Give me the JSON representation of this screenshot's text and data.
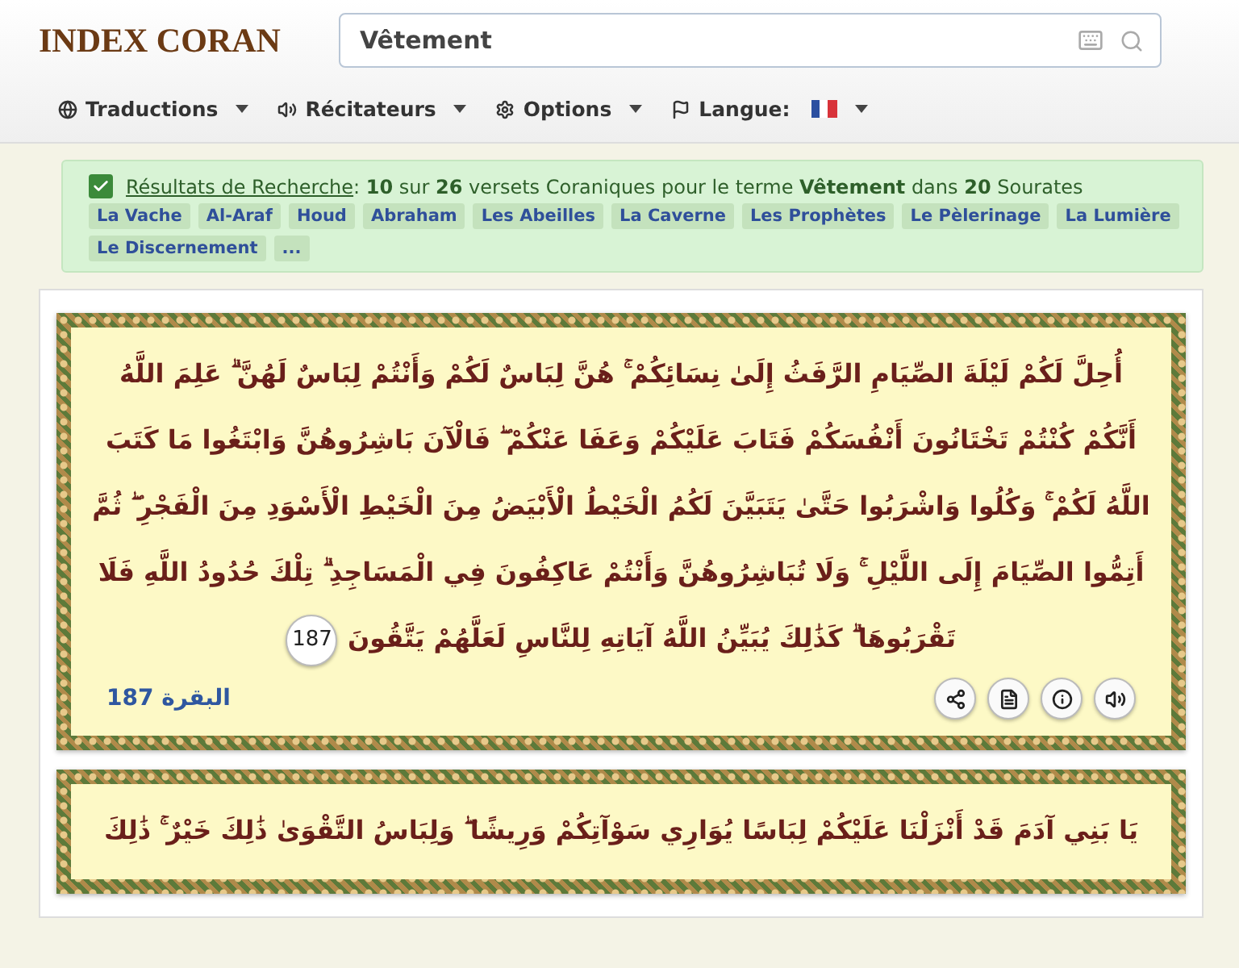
{
  "logo": {
    "text": "INDEX CORAN"
  },
  "search": {
    "value": "Vêtement"
  },
  "nav": [
    {
      "label": "Traductions",
      "kind": "menu"
    },
    {
      "label": "Récitateurs",
      "kind": "menu"
    },
    {
      "label": "Options",
      "kind": "menu"
    },
    {
      "label": "Langue:",
      "kind": "language"
    }
  ],
  "results": {
    "checked": true,
    "link": "Résultats de Recherche",
    "summary": ": **10** sur **26** versets Coraniques pour le terme **Vêtement** dans **20** Sourates",
    "tags": [
      "La Vache",
      "Al-Araf",
      "Houd",
      "Abraham",
      "Les Abeilles",
      "La Caverne",
      "Les Prophètes",
      "Le Pèlerinage",
      "La Lumière",
      "Le Discernement",
      "..."
    ]
  },
  "verses": [
    {
      "text": "أُحِلَّ لَكُمْ لَيْلَةَ الصِّيَامِ الرَّفَثُ إِلَىٰ نِسَائِكُمْ ۚ هُنَّ لِبَاسٌ لَكُمْ وَأَنْتُمْ لِبَاسٌ لَهُنَّ ۗ عَلِمَ اللَّهُ أَنَّكُمْ كُنْتُمْ تَخْتَانُونَ أَنْفُسَكُمْ فَتَابَ عَلَيْكُمْ وَعَفَا عَنْكُمْ ۖ فَالْآنَ بَاشِرُوهُنَّ وَابْتَغُوا مَا كَتَبَ اللَّهُ لَكُمْ ۚ وَكُلُوا وَاشْرَبُوا حَتَّىٰ يَتَبَيَّنَ لَكُمُ الْخَيْطُ الْأَبْيَضُ مِنَ الْخَيْطِ الْأَسْوَدِ مِنَ الْفَجْرِ ۖ ثُمَّ أَتِمُّوا الصِّيَامَ إِلَى اللَّيْلِ ۚ وَلَا تُبَاشِرُوهُنَّ وَأَنْتُمْ عَاكِفُونَ فِي الْمَسَاجِدِ ۗ تِلْكَ حُدُودُ اللَّهِ فَلَا تَقْرَبُوهَا ۗ كَذَٰلِكَ يُبَيِّنُ اللَّهُ آيَاتِهِ لِلنَّاسِ لَعَلَّهُمْ يَتَّقُونَ",
      "number": "187",
      "reference": "البقرة 187"
    },
    {
      "text": "يَا بَنِي آدَمَ قَدْ أَنْزَلْنَا عَلَيْكُمْ لِبَاسًا يُوَارِي سَوْآتِكُمْ وَرِيشًا ۖ وَلِبَاسُ التَّقْوَىٰ ذَٰلِكَ خَيْرٌ ۚ ذَٰلِكَ"
    }
  ]
}
